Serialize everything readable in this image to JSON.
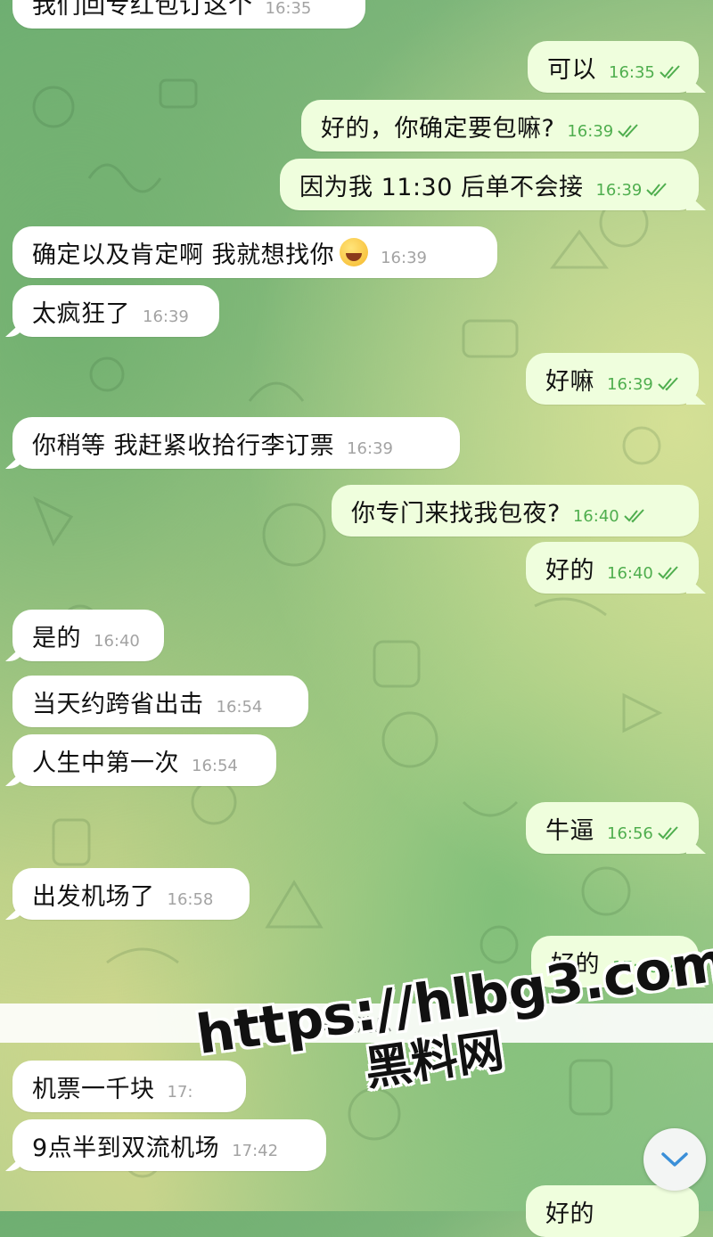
{
  "chat": {
    "unread_label": "未读消息",
    "watermark": {
      "url": "https://hlbg3.com",
      "site": "黑料网"
    },
    "messages": [
      {
        "dir": "in",
        "text": "我们回专红包订这个",
        "time": "16:35"
      },
      {
        "dir": "out",
        "text": "可以",
        "time": "16:35",
        "read": true
      },
      {
        "dir": "out",
        "text": "好的，你确定要包嘛?",
        "time": "16:39",
        "read": true
      },
      {
        "dir": "out",
        "text": "因为我 11:30 后单不会接",
        "time": "16:39",
        "read": true
      },
      {
        "dir": "in",
        "text": "确定以及肯定啊 我就想找你",
        "emoji": "face-with-tears-of-joy",
        "time": "16:39"
      },
      {
        "dir": "in",
        "text": "太疯狂了",
        "time": "16:39"
      },
      {
        "dir": "out",
        "text": "好嘛",
        "time": "16:39",
        "read": true
      },
      {
        "dir": "in",
        "text": "你稍等 我赶紧收拾行李订票",
        "time": "16:39"
      },
      {
        "dir": "out",
        "text": "你专门来找我包夜?",
        "time": "16:40",
        "read": true
      },
      {
        "dir": "out",
        "text": "好的",
        "time": "16:40",
        "read": true
      },
      {
        "dir": "in",
        "text": "是的",
        "time": "16:40"
      },
      {
        "dir": "in",
        "text": "当天约跨省出击",
        "time": "16:54"
      },
      {
        "dir": "in",
        "text": "人生中第一次",
        "time": "16:54"
      },
      {
        "dir": "out",
        "text": "牛逼",
        "time": "16:56",
        "read": true
      },
      {
        "dir": "in",
        "text": "出发机场了",
        "time": "16:58"
      },
      {
        "dir": "out",
        "text": "好的",
        "time": "17:10",
        "read": true
      },
      {
        "dir": "in",
        "text": "机票一千块",
        "time": "17:"
      },
      {
        "dir": "in",
        "text": "9点半到双流机场",
        "time": "17:42"
      },
      {
        "dir": "out",
        "text": "好的",
        "time": ""
      }
    ]
  },
  "colors": {
    "incoming_bubble": "#ffffff",
    "outgoing_bubble": "#effedd",
    "read_tick": "#4fae4e",
    "time_incoming": "#a3a3a3"
  },
  "icons": {
    "read_receipt": "double-check-icon",
    "scroll_down": "chevron-down-icon",
    "emoji": "face-with-tears-of-joy"
  }
}
